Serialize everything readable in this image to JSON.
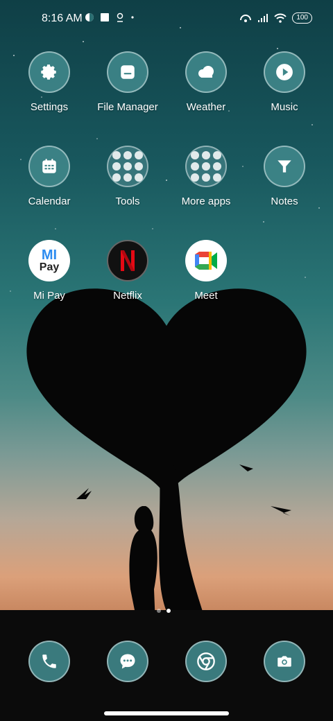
{
  "status": {
    "time": "8:16 AM",
    "battery": "100"
  },
  "apps": {
    "settings": "Settings",
    "file_manager": "File Manager",
    "weather": "Weather",
    "music": "Music",
    "calendar": "Calendar",
    "tools": "Tools",
    "more_apps": "More apps",
    "notes": "Notes",
    "mi_pay": "Mi Pay",
    "netflix": "Netflix",
    "meet": "Meet"
  },
  "mipay_logo": {
    "top": "MI",
    "bottom": "Pay"
  },
  "page_indicator": {
    "pages": 2,
    "active": 2
  },
  "icons": [
    "phone-icon",
    "messages-icon",
    "chrome-icon",
    "camera-icon"
  ],
  "colors": {
    "icon_bg": "#3f8689",
    "accent": "#ffffff"
  }
}
